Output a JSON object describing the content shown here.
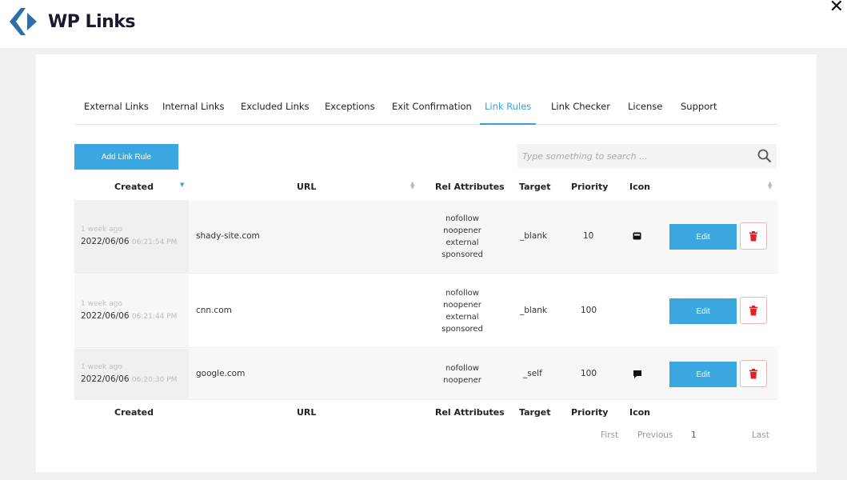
{
  "app": {
    "logo_text": "WP Links",
    "close_glyph": "✕",
    "colors": {
      "accent": "#3aa7e0",
      "delete": "#e02424"
    }
  },
  "tabs": [
    {
      "label": "External Links"
    },
    {
      "label": "Internal Links"
    },
    {
      "label": "Excluded Links"
    },
    {
      "label": "Exceptions"
    },
    {
      "label": "Exit Confirmation"
    },
    {
      "label": "Link Rules",
      "active": true
    },
    {
      "label": "Link Checker"
    },
    {
      "label": "License"
    },
    {
      "label": "Support"
    }
  ],
  "toolbar": {
    "add_label": "Add Link Rule",
    "search_placeholder": "Type something to search ..."
  },
  "table": {
    "headers": {
      "created": "Created",
      "url": "URL",
      "rel": "Rel Attributes",
      "target": "Target",
      "priority": "Priority",
      "icon": "Icon"
    },
    "rows": [
      {
        "ago": "1 week ago",
        "date": "2022/06/06",
        "time": "06:21:54 PM",
        "url": "shady-site.com",
        "rel": [
          "nofollow",
          "noopener",
          "external",
          "sponsored"
        ],
        "target": "_blank",
        "priority": "10",
        "icon": "box-icon",
        "edit_label": "Edit"
      },
      {
        "ago": "1 week ago",
        "date": "2022/06/06",
        "time": "06:21:44 PM",
        "url": "cnn.com",
        "rel": [
          "nofollow",
          "noopener",
          "external",
          "sponsored"
        ],
        "target": "_blank",
        "priority": "100",
        "icon": "",
        "edit_label": "Edit"
      },
      {
        "ago": "1 week ago",
        "date": "2022/06/06",
        "time": "06:20:30 PM",
        "url": "google.com",
        "rel": [
          "nofollow",
          "noopener"
        ],
        "target": "_self",
        "priority": "100",
        "icon": "comment-icon",
        "edit_label": "Edit"
      }
    ]
  },
  "pagination": {
    "first": "First",
    "previous": "Previous",
    "page": "1",
    "last": "Last"
  }
}
